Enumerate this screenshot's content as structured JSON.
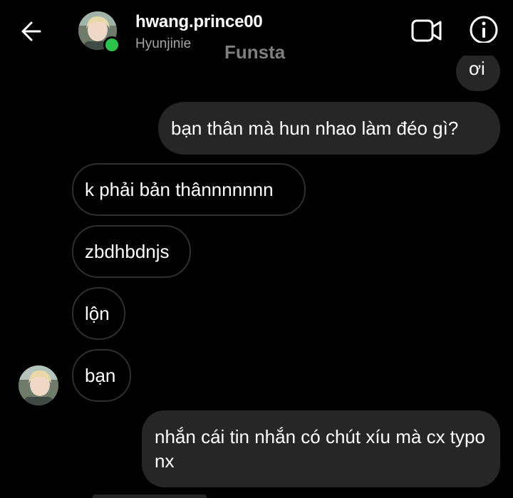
{
  "header": {
    "username": "hwang.prince00",
    "subtitle": "Hyunjinie",
    "watermark": "Funsta"
  },
  "colors": {
    "background": "#000000",
    "outgoing_bubble": "#262626",
    "incoming_border": "#2e2e2e",
    "online": "#2cc34a",
    "secondary_text": "#a6a6a6"
  },
  "icons": {
    "back": "arrow-left",
    "video_call": "video-camera",
    "info": "info-circle"
  },
  "messages": [
    {
      "direction": "out",
      "text": "ơi"
    },
    {
      "direction": "out",
      "text": "bạn thân mà hun nhao làm đéo gì?"
    },
    {
      "direction": "in",
      "text": "k phải bản thânnnnnnn"
    },
    {
      "direction": "in",
      "text": "zbdhbdnjs"
    },
    {
      "direction": "in",
      "text": "lộn"
    },
    {
      "direction": "in",
      "text": "bạn",
      "show_avatar": true
    },
    {
      "direction": "out",
      "text": "nhắn cái tin nhắn có chút xíu mà cx typo nx"
    }
  ]
}
